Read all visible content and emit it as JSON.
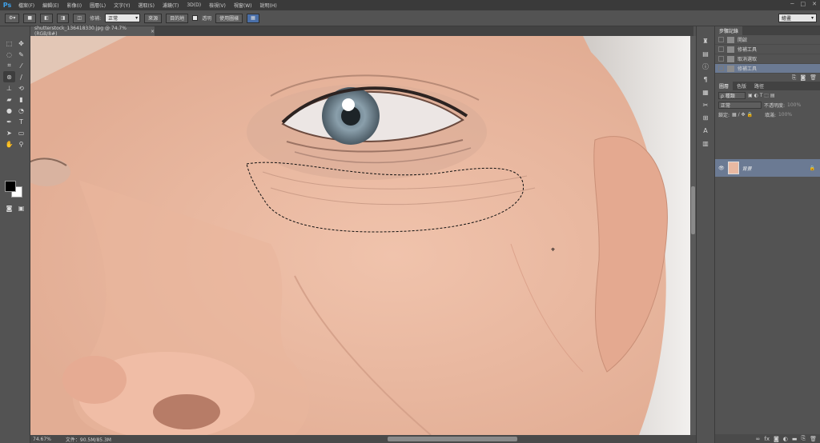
{
  "app": {
    "logo": "Ps"
  },
  "menu": [
    "檔案(F)",
    "編輯(E)",
    "影像(I)",
    "圖層(L)",
    "文字(Y)",
    "選取(S)",
    "濾鏡(T)",
    "3D(D)",
    "檢視(V)",
    "視窗(W)",
    "說明(H)"
  ],
  "window_controls": {
    "minimize": "─",
    "maximize": "□",
    "close": "✕"
  },
  "options": {
    "blend_label": "修補:",
    "blend_value": "正常",
    "source_label": "來源",
    "dest_label": "目的地",
    "transparent_label": "透明",
    "use_pattern_label": "使用圖樣"
  },
  "workspace": {
    "value": "繪畫"
  },
  "document": {
    "tab_title": "shutterstock_136418330.jpg @ 74.7% (RGB/8#)",
    "close": "×"
  },
  "status": {
    "zoom": "74.67%",
    "doc_label": "文件：90.5M/85.3M"
  },
  "history": {
    "tab": "步驟記錄",
    "items": [
      {
        "label": "開啟",
        "selected": false
      },
      {
        "label": "修補工具",
        "selected": false
      },
      {
        "label": "取消選取",
        "selected": false
      },
      {
        "label": "修補工具",
        "selected": true
      }
    ]
  },
  "layers": {
    "tabs": [
      "圖層",
      "色版",
      "路徑"
    ],
    "filter_value": "ρ 種類",
    "blend_value": "正常",
    "opacity_label": "不透明度:",
    "opacity_value": "100%",
    "lock_label": "鎖定:",
    "fill_label": "填滿:",
    "fill_value": "100%",
    "items": [
      {
        "name": "背景"
      }
    ]
  },
  "colors": {
    "accent": "#6b7a93",
    "ps_blue": "#3fa0e8"
  }
}
